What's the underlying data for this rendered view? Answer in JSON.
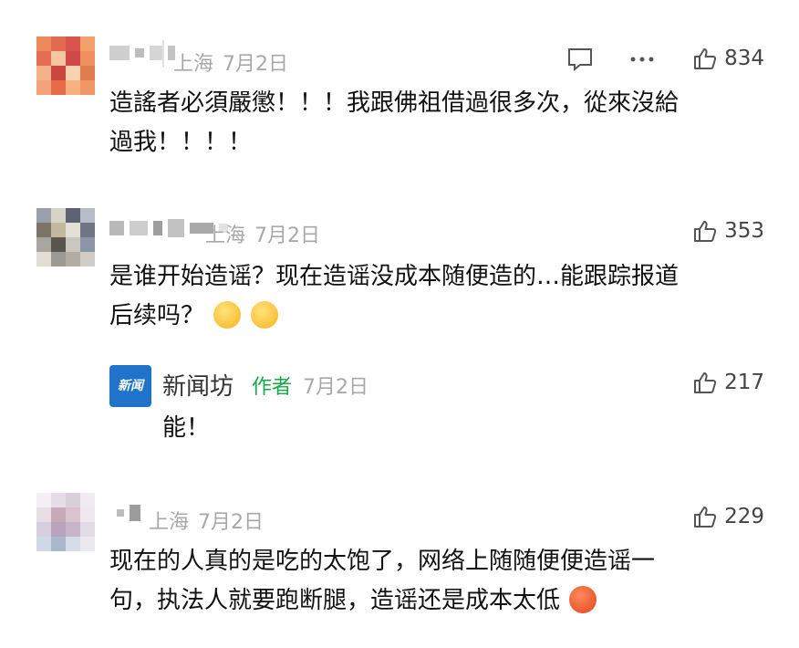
{
  "comments": [
    {
      "location": "上海",
      "date": "7月2日",
      "likes": "834",
      "text_lines": [
        "造謠者必須嚴懲！！！我跟佛祖借過很多次，從來沒給",
        "過我！！！！"
      ],
      "icons": [
        "reply-icon",
        "more-icon",
        "thumbs-up-icon"
      ]
    },
    {
      "location": "上海",
      "date": "7月2日",
      "likes": "353",
      "text_lines": [
        "是谁开始造谣？现在造谣没成本随便造的…能跟踪报道",
        "后续吗？"
      ],
      "emojis": [
        "thinking-emoji",
        "thinking-emoji"
      ]
    },
    {
      "location": "上海",
      "date": "7月2日",
      "likes": "229",
      "text_lines": [
        "现在的人真的是吃的太饱了，网络上随随便便造谣一",
        "句，执法人就要跑断腿，造谣还是成本太低"
      ],
      "emojis": [
        "angry-emoji"
      ]
    }
  ],
  "reply": {
    "name": "新闻坊",
    "avatar_text": "新闻",
    "author_badge": "作者",
    "date": "7月2日",
    "likes": "217",
    "text": "能！"
  },
  "colors": {
    "meta_gray": "#a8a8a8",
    "author_green": "#19a74a",
    "brand_blue": "#1f73c9"
  }
}
